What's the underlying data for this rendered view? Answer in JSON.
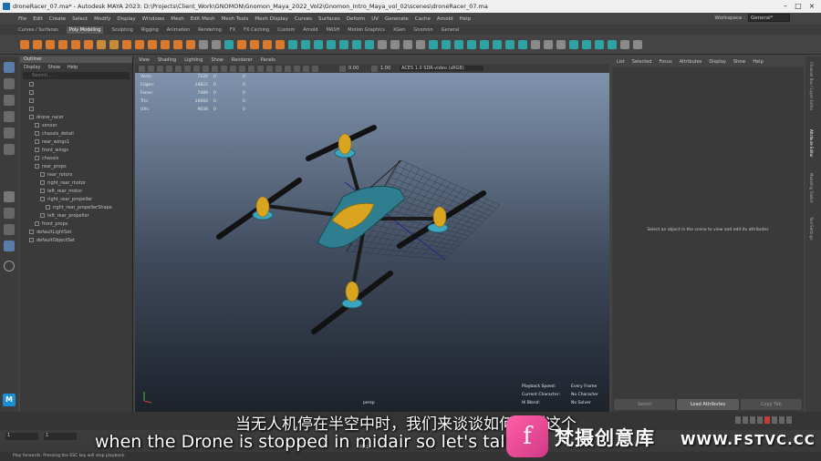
{
  "title": "droneRacer_07.ma* - Autodesk MAYA 2023: D:\\Projects\\Client_Work\\GNOMON\\Gnomon_Maya_2022_Vol2\\Gnomon_Intro_Maya_vol_02\\scenes\\droneRacer_07.ma",
  "menus": [
    "File",
    "Edit",
    "Create",
    "Select",
    "Modify",
    "Display",
    "Windows",
    "Mesh",
    "Edit Mesh",
    "Mesh Tools",
    "Mesh Display",
    "Curves",
    "Surfaces",
    "Deform",
    "UV",
    "Generate",
    "Cache",
    "Arnold",
    "Help"
  ],
  "workspace": {
    "label": "Workspace :",
    "value": "General*"
  },
  "shelf_tabs": [
    "Curves / Surfaces",
    "Poly Modeling",
    "Sculpting",
    "Rigging",
    "Animation",
    "Rendering",
    "FX",
    "FX Caching",
    "Custom",
    "Arnold",
    "MASH",
    "Motion Graphics",
    "XGen",
    "Gnomon",
    "General"
  ],
  "shelf_active": "Poly Modeling",
  "outliner": {
    "title": "Outliner",
    "menus": [
      "Display",
      "Show",
      "Help"
    ],
    "search_placeholder": "Search...",
    "items": [
      {
        "label": "",
        "indent": 0
      },
      {
        "label": "",
        "indent": 0
      },
      {
        "label": "",
        "indent": 0
      },
      {
        "label": "",
        "indent": 0
      },
      {
        "label": "drone_racer",
        "indent": 0
      },
      {
        "label": "sensor",
        "indent": 1
      },
      {
        "label": "chassis_detail",
        "indent": 1
      },
      {
        "label": "rear_wings1",
        "indent": 1
      },
      {
        "label": "front_wings",
        "indent": 1
      },
      {
        "label": "chassis",
        "indent": 1
      },
      {
        "label": "rear_props",
        "indent": 1
      },
      {
        "label": "rear_rotors",
        "indent": 2
      },
      {
        "label": "right_rear_motor",
        "indent": 2
      },
      {
        "label": "left_rear_motor",
        "indent": 2
      },
      {
        "label": "right_rear_propeller",
        "indent": 2
      },
      {
        "label": "right_rear_propellerShape",
        "indent": 3
      },
      {
        "label": "left_rear_propeller",
        "indent": 2
      },
      {
        "label": "front_props",
        "indent": 1
      },
      {
        "label": "defaultLightSet",
        "indent": 0
      },
      {
        "label": "defaultObjectSet",
        "indent": 0
      }
    ]
  },
  "viewport": {
    "menus": [
      "View",
      "Shading",
      "Lighting",
      "Show",
      "Renderer",
      "Panels"
    ],
    "exposure": "0.00",
    "gamma": "1.00",
    "colorspace": "ACES 1.0 SDR-video (sRGB)",
    "camera": "persp",
    "hud_stats": [
      {
        "label": "Verts:",
        "a": "7220",
        "b": "0",
        "c": "0"
      },
      {
        "label": "Edges:",
        "a": "14822",
        "b": "0",
        "c": "0"
      },
      {
        "label": "Faces:",
        "a": "7480",
        "b": "0",
        "c": "0"
      },
      {
        "label": "Tris:",
        "a": "14664",
        "b": "0",
        "c": "0"
      },
      {
        "label": "UVs:",
        "a": "9038",
        "b": "0",
        "c": "0"
      }
    ],
    "hud_playback": [
      {
        "label": "Playback Speed:",
        "value": "Every Frame"
      },
      {
        "label": "Current Character:",
        "value": "No Character"
      },
      {
        "label": "IK Blend:",
        "value": "No Solver"
      }
    ]
  },
  "attribute_editor": {
    "menus": [
      "List",
      "Selected",
      "Focus",
      "Attributes",
      "Display",
      "Show",
      "Help"
    ],
    "message": "Select an object in the scene to view and edit its attributes",
    "buttons": [
      "Select",
      "Load Attributes",
      "Copy Tab"
    ],
    "side_tabs": [
      "Channel Box / Layer Editor",
      "Attribute Editor",
      "Modeling Toolkit",
      "Tool Settings"
    ]
  },
  "timeline": {
    "start": "1",
    "end": "1",
    "script_type": "MEL"
  },
  "help_line": "Play forwards. Pressing the ESC key will stop playback.",
  "subtitles": {
    "cn": "当无人机停在半空中时，我们来谈谈如何复制这个",
    "en": "when the Drone is stopped in midair so let's talk a"
  },
  "watermark": {
    "cn": "梵摄创意库",
    "url": "WWW.FSTVC.CC"
  },
  "colors": {
    "accent": "#e07a2e",
    "viewport_top": "#7f93ad",
    "viewport_bottom": "#1d222b",
    "drone_body": "#2f7e8f",
    "drone_yellow": "#d9a520"
  }
}
